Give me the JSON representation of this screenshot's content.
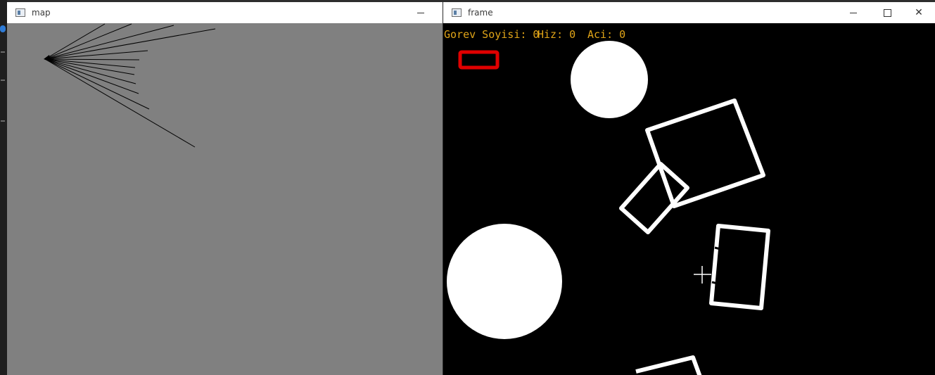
{
  "map_window": {
    "title": "map",
    "minimize_glyph": "—"
  },
  "frame_window": {
    "title": "frame",
    "minimize_glyph": "—",
    "close_glyph": "✕"
  },
  "hud": {
    "gorev_text": "Gorev Soyisi: 0",
    "hiz_text": "Hiz: 0",
    "aci_text": "Aci: 0",
    "text_color": "#e0a418"
  },
  "colors": {
    "map_background": "#808080",
    "frame_background": "#000000",
    "shape_color": "#ffffff",
    "marker_color": "#e00000"
  }
}
